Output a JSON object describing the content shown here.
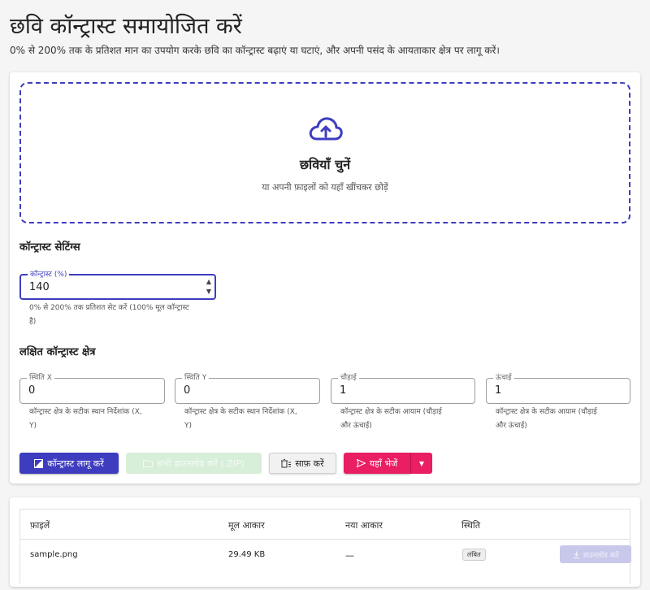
{
  "header": {
    "title": "छवि कॉन्ट्रास्ट समायोजित करें",
    "description": "0% से 200% तक के प्रतिशत मान का उपयोग करके छवि का कॉन्ट्रास्ट बढ़ाएं या घटाएं, और अपनी पसंद के आयताकार क्षेत्र पर लागू करें।"
  },
  "dropzone": {
    "title": "छवियाँ चुनें",
    "subtitle": "या अपनी फ़ाइलों को यहाँ खींचकर छोड़ें",
    "icon": "cloud-upload-icon"
  },
  "contrast_settings": {
    "title": "कॉन्ट्रास्ट सेटिंग्स",
    "contrast_label": "कॉन्ट्रास्ट (%)",
    "contrast_value": "140",
    "helper_line1": "0% से 200% तक प्रतिशत सेट करें (100% मूल कॉन्ट्रास्ट",
    "helper_line2": "है)"
  },
  "region": {
    "title": "लक्षित कॉन्ट्रास्ट क्षेत्र",
    "fields": [
      {
        "label": "स्थिति X",
        "value": "0",
        "helper1": "कॉन्ट्रास्ट क्षेत्र के सटीक स्थान निर्देशांक (X,",
        "helper2": "Y)"
      },
      {
        "label": "स्थिति Y",
        "value": "0",
        "helper1": "कॉन्ट्रास्ट क्षेत्र के सटीक स्थान निर्देशांक (X,",
        "helper2": "Y)"
      },
      {
        "label": "चौड़ाई",
        "value": "1",
        "helper1": "कॉन्ट्रास्ट क्षेत्र के सटीक आयाम (चौड़ाई",
        "helper2": "और ऊंचाई)"
      },
      {
        "label": "ऊंचाई",
        "value": "1",
        "helper1": "कॉन्ट्रास्ट क्षेत्र के सटीक आयाम (चौड़ाई",
        "helper2": "और ऊंचाई)"
      }
    ]
  },
  "actions": {
    "apply": "कॉन्ट्रास्ट लागू करें",
    "download_all": "सभी डाउनलोड करें (.ZIP)",
    "clear": "साफ़ करें",
    "send": "यहाँ भेजें"
  },
  "files_table": {
    "headers": [
      "फ़ाइलें",
      "मूल आकार",
      "नया आकार",
      "स्थिति"
    ],
    "rows": [
      {
        "name": "sample.png",
        "original_size": "29.49 KB",
        "new_size": "—",
        "status": "लंबित",
        "download": "डाउनलोड करें"
      }
    ]
  },
  "colors": {
    "primary": "#3f3dbf",
    "send": "#e91e63"
  }
}
